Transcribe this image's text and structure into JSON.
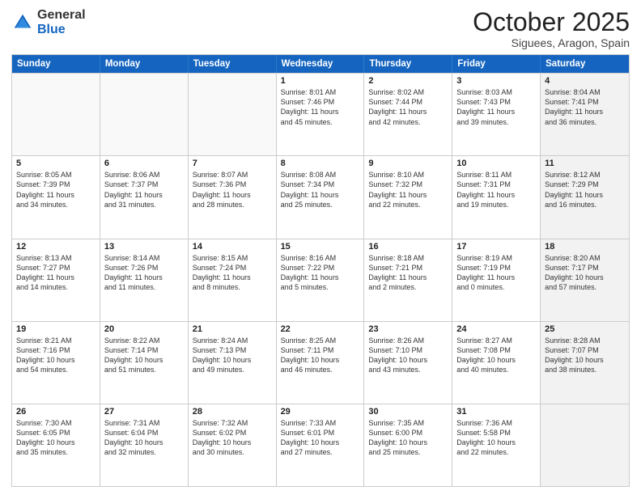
{
  "logo": {
    "general": "General",
    "blue": "Blue"
  },
  "header": {
    "month": "October 2025",
    "location": "Siguees, Aragon, Spain"
  },
  "days": [
    "Sunday",
    "Monday",
    "Tuesday",
    "Wednesday",
    "Thursday",
    "Friday",
    "Saturday"
  ],
  "rows": [
    [
      {
        "day": "",
        "info": "",
        "empty": true
      },
      {
        "day": "",
        "info": "",
        "empty": true
      },
      {
        "day": "",
        "info": "",
        "empty": true
      },
      {
        "day": "1",
        "info": "Sunrise: 8:01 AM\nSunset: 7:46 PM\nDaylight: 11 hours\nand 45 minutes."
      },
      {
        "day": "2",
        "info": "Sunrise: 8:02 AM\nSunset: 7:44 PM\nDaylight: 11 hours\nand 42 minutes."
      },
      {
        "day": "3",
        "info": "Sunrise: 8:03 AM\nSunset: 7:43 PM\nDaylight: 11 hours\nand 39 minutes."
      },
      {
        "day": "4",
        "info": "Sunrise: 8:04 AM\nSunset: 7:41 PM\nDaylight: 11 hours\nand 36 minutes.",
        "shaded": true
      }
    ],
    [
      {
        "day": "5",
        "info": "Sunrise: 8:05 AM\nSunset: 7:39 PM\nDaylight: 11 hours\nand 34 minutes."
      },
      {
        "day": "6",
        "info": "Sunrise: 8:06 AM\nSunset: 7:37 PM\nDaylight: 11 hours\nand 31 minutes."
      },
      {
        "day": "7",
        "info": "Sunrise: 8:07 AM\nSunset: 7:36 PM\nDaylight: 11 hours\nand 28 minutes."
      },
      {
        "day": "8",
        "info": "Sunrise: 8:08 AM\nSunset: 7:34 PM\nDaylight: 11 hours\nand 25 minutes."
      },
      {
        "day": "9",
        "info": "Sunrise: 8:10 AM\nSunset: 7:32 PM\nDaylight: 11 hours\nand 22 minutes."
      },
      {
        "day": "10",
        "info": "Sunrise: 8:11 AM\nSunset: 7:31 PM\nDaylight: 11 hours\nand 19 minutes."
      },
      {
        "day": "11",
        "info": "Sunrise: 8:12 AM\nSunset: 7:29 PM\nDaylight: 11 hours\nand 16 minutes.",
        "shaded": true
      }
    ],
    [
      {
        "day": "12",
        "info": "Sunrise: 8:13 AM\nSunset: 7:27 PM\nDaylight: 11 hours\nand 14 minutes."
      },
      {
        "day": "13",
        "info": "Sunrise: 8:14 AM\nSunset: 7:26 PM\nDaylight: 11 hours\nand 11 minutes."
      },
      {
        "day": "14",
        "info": "Sunrise: 8:15 AM\nSunset: 7:24 PM\nDaylight: 11 hours\nand 8 minutes."
      },
      {
        "day": "15",
        "info": "Sunrise: 8:16 AM\nSunset: 7:22 PM\nDaylight: 11 hours\nand 5 minutes."
      },
      {
        "day": "16",
        "info": "Sunrise: 8:18 AM\nSunset: 7:21 PM\nDaylight: 11 hours\nand 2 minutes."
      },
      {
        "day": "17",
        "info": "Sunrise: 8:19 AM\nSunset: 7:19 PM\nDaylight: 11 hours\nand 0 minutes."
      },
      {
        "day": "18",
        "info": "Sunrise: 8:20 AM\nSunset: 7:17 PM\nDaylight: 10 hours\nand 57 minutes.",
        "shaded": true
      }
    ],
    [
      {
        "day": "19",
        "info": "Sunrise: 8:21 AM\nSunset: 7:16 PM\nDaylight: 10 hours\nand 54 minutes."
      },
      {
        "day": "20",
        "info": "Sunrise: 8:22 AM\nSunset: 7:14 PM\nDaylight: 10 hours\nand 51 minutes."
      },
      {
        "day": "21",
        "info": "Sunrise: 8:24 AM\nSunset: 7:13 PM\nDaylight: 10 hours\nand 49 minutes."
      },
      {
        "day": "22",
        "info": "Sunrise: 8:25 AM\nSunset: 7:11 PM\nDaylight: 10 hours\nand 46 minutes."
      },
      {
        "day": "23",
        "info": "Sunrise: 8:26 AM\nSunset: 7:10 PM\nDaylight: 10 hours\nand 43 minutes."
      },
      {
        "day": "24",
        "info": "Sunrise: 8:27 AM\nSunset: 7:08 PM\nDaylight: 10 hours\nand 40 minutes."
      },
      {
        "day": "25",
        "info": "Sunrise: 8:28 AM\nSunset: 7:07 PM\nDaylight: 10 hours\nand 38 minutes.",
        "shaded": true
      }
    ],
    [
      {
        "day": "26",
        "info": "Sunrise: 7:30 AM\nSunset: 6:05 PM\nDaylight: 10 hours\nand 35 minutes."
      },
      {
        "day": "27",
        "info": "Sunrise: 7:31 AM\nSunset: 6:04 PM\nDaylight: 10 hours\nand 32 minutes."
      },
      {
        "day": "28",
        "info": "Sunrise: 7:32 AM\nSunset: 6:02 PM\nDaylight: 10 hours\nand 30 minutes."
      },
      {
        "day": "29",
        "info": "Sunrise: 7:33 AM\nSunset: 6:01 PM\nDaylight: 10 hours\nand 27 minutes."
      },
      {
        "day": "30",
        "info": "Sunrise: 7:35 AM\nSunset: 6:00 PM\nDaylight: 10 hours\nand 25 minutes."
      },
      {
        "day": "31",
        "info": "Sunrise: 7:36 AM\nSunset: 5:58 PM\nDaylight: 10 hours\nand 22 minutes."
      },
      {
        "day": "",
        "info": "",
        "empty": true,
        "shaded": true
      }
    ]
  ]
}
